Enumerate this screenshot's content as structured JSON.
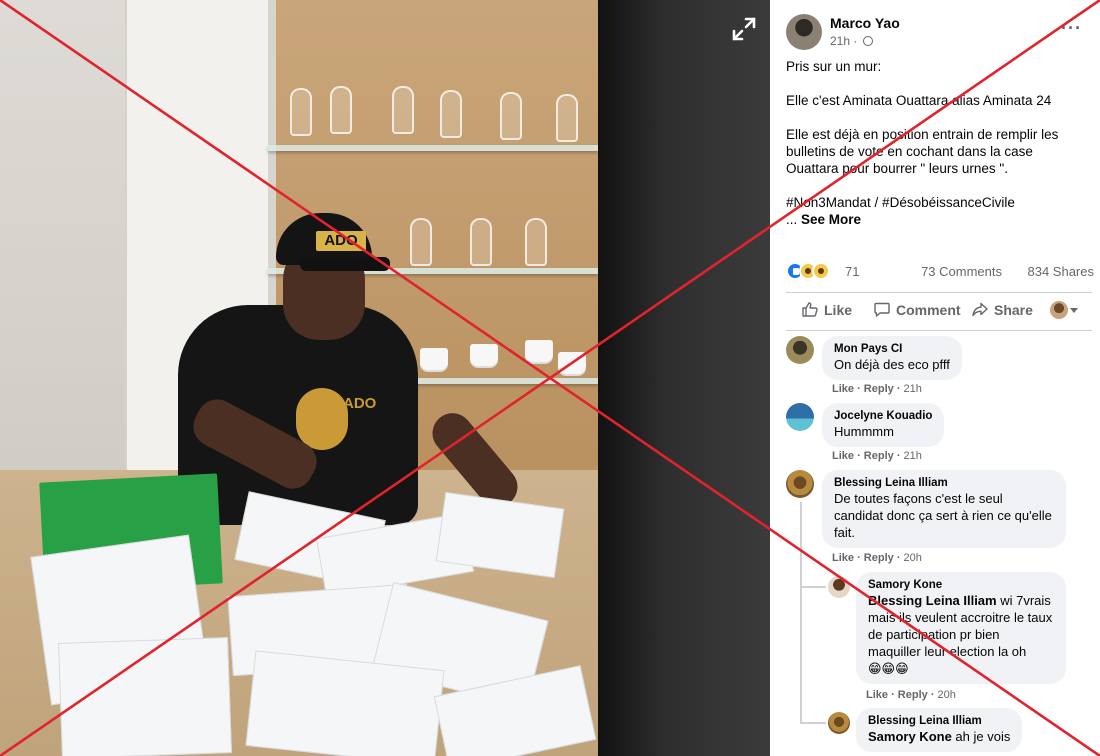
{
  "post": {
    "author": "Marco Yao",
    "time": "21h",
    "text": {
      "line1": "Pris sur un mur:",
      "line2": "Elle c'est Aminata Ouattara alias Aminata 24",
      "line3": "Elle est déjà en position entrain de remplir les bulletins de vote en cochant dans la case Ouattara pour bourrer \" leurs urnes \".",
      "hashtags": "#Non3Mandat / #DésobéissanceCivile",
      "ellipsis": "... ",
      "see_more": "See More"
    },
    "reactions": {
      "count": "71",
      "types": [
        "like-icon",
        "wow-icon",
        "haha-icon"
      ]
    },
    "comments_count": "73 Comments",
    "shares_count": "834 Shares",
    "actions": {
      "like": "Like",
      "comment": "Comment",
      "share": "Share"
    }
  },
  "photo": {
    "cap_text": "ADO",
    "shirt_text": "ADO"
  },
  "comments": [
    {
      "name": "Mon Pays CI",
      "text": "On déjà des eco pfff",
      "like": "Like",
      "reply": "Reply",
      "time": "21h"
    },
    {
      "name": "Jocelyne Kouadio",
      "text": "Hummmm",
      "like": "Like",
      "reply": "Reply",
      "time": "21h"
    },
    {
      "name": "Blessing Leina Illiam",
      "text": "De toutes façons c'est le seul candidat donc ça sert à rien ce qu'elle fait.",
      "like": "Like",
      "reply": "Reply",
      "time": "20h"
    }
  ],
  "replies": [
    {
      "name": "Samory Kone",
      "mention": "Blessing Leina Illiam",
      "text": " wi 7vrais mais ils veulent accroitre le taux de participation pr bien maquiller leur election la oh",
      "emoji": "😁😁😁",
      "like": "Like",
      "reply": "Reply",
      "time": "20h"
    },
    {
      "name": "Blessing Leina Illiam",
      "mention": "Samory Kone",
      "text": " ah je vois"
    }
  ],
  "colors": {
    "cross": "#e0232d",
    "link_blue": "#1877f2",
    "bubble": "#f0f2f5",
    "secondary_text": "#65676b"
  }
}
